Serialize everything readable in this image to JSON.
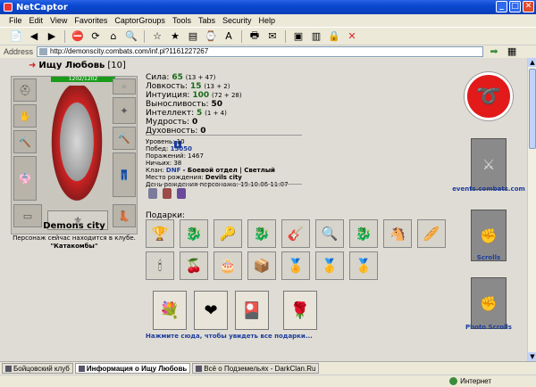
{
  "window": {
    "title": "NetCaptor"
  },
  "menu": [
    "File",
    "Edit",
    "View",
    "Favorites",
    "CaptorGroups",
    "Tools",
    "Tabs",
    "Security",
    "Help"
  ],
  "address": {
    "label": "Address",
    "url": "http://demonscity.combats.com/inf.pl?1161227267"
  },
  "character": {
    "name": "Ищу Любовь",
    "level": "[10]",
    "hp": "1202/1202",
    "city": "Demons city",
    "location_note": "Персонаж сейчас находится в клубе.",
    "location": "\"Катакомбы\""
  },
  "stats": [
    {
      "label": "Сила:",
      "value": "65",
      "detail": "(13 + 47)"
    },
    {
      "label": "Ловкость:",
      "value": "15",
      "detail": "(13 + 2)"
    },
    {
      "label": "Интуиция:",
      "value": "100",
      "detail": "(72 + 28)"
    },
    {
      "label": "Выносливость:",
      "value": "50",
      "detail": ""
    },
    {
      "label": "Интеллект:",
      "value": "5",
      "detail": "(1 + 4)"
    },
    {
      "label": "Мудрость:",
      "value": "0",
      "detail": ""
    },
    {
      "label": "Духовность:",
      "value": "0",
      "detail": ""
    }
  ],
  "info": {
    "level": "Уровень: 10",
    "wins_label": "Побед:",
    "wins": "15050",
    "losses": "Поражений: 1467",
    "draws": "Ничьих: 38",
    "clan_label": "Клан:",
    "clan": "DNF",
    "clan_rest": "- Боевой отдел | Светлый",
    "birthplace_label": "Место рождения:",
    "birthplace": "Devils city",
    "birthday": "День рождения персонажа: 19.10.06 11:07"
  },
  "gifts": {
    "label": "Подарки:",
    "icons_row1": [
      "🏆",
      "🐉",
      "🔑",
      "🐉",
      "🎸",
      "🔍",
      "🐉",
      "🐴",
      "🥖"
    ],
    "icons_row2": [
      "🕯",
      "🍒",
      "🎂",
      "📦",
      "🏅",
      "🥇",
      "🥇"
    ],
    "cards": [
      "💐",
      "❤",
      "🎴",
      "🌹"
    ],
    "more_link": "Нажмите сюда, чтобы увидеть все подарки..."
  },
  "side": {
    "site_link": "events.combats.com",
    "scrolls": "Scrolls",
    "photo_scrolls": "Photo Scrolls"
  },
  "taskbar": [
    {
      "label": "Бойцовский клуб",
      "active": false
    },
    {
      "label": "Информация о Ищу Любовь",
      "active": true
    },
    {
      "label": "Всё о Подземельях - DarkClan.Ru",
      "active": false
    }
  ],
  "status": {
    "zone": "Интернет"
  }
}
